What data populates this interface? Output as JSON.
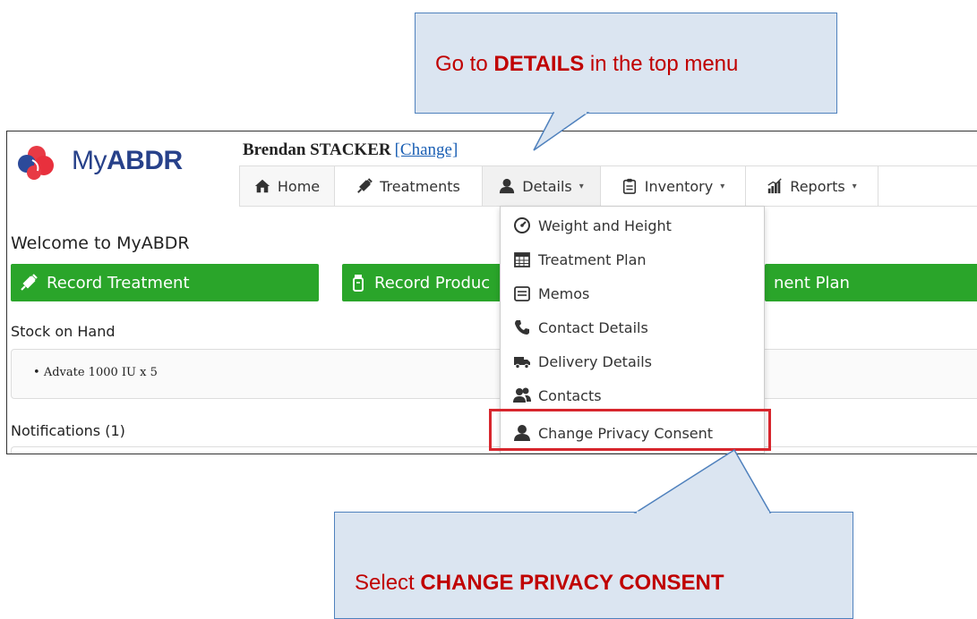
{
  "annotations": {
    "top": {
      "prefix": "Go to ",
      "emphasis": "DETAILS",
      "suffix": " in the top menu"
    },
    "bottom": {
      "prefix": "Select ",
      "emphasis": "CHANGE PRIVACY CONSENT"
    },
    "callout_fill": "#dbe5f1",
    "callout_border": "#4f81bd",
    "text_color": "#c00000",
    "highlight_color": "#d7262d"
  },
  "app": {
    "logo": {
      "light": "My",
      "bold": "ABDR"
    },
    "user": {
      "name": "Brendan STACKER",
      "change_link": "[Change]"
    }
  },
  "nav": {
    "home": {
      "label": "Home",
      "icon": "home-icon"
    },
    "treatments": {
      "label": "Treatments",
      "icon": "syringe-icon"
    },
    "details": {
      "label": "Details",
      "icon": "user-icon"
    },
    "inventory": {
      "label": "Inventory",
      "icon": "clipboard-icon"
    },
    "reports": {
      "label": "Reports",
      "icon": "bar-chart-icon"
    },
    "caret": "▾"
  },
  "details_menu": {
    "items": [
      {
        "label": "Weight and Height",
        "icon": "dashboard-icon"
      },
      {
        "label": "Treatment Plan",
        "icon": "calendar-icon"
      },
      {
        "label": "Memos",
        "icon": "memo-icon"
      },
      {
        "label": "Contact Details",
        "icon": "phone-icon"
      },
      {
        "label": "Delivery Details",
        "icon": "truck-icon"
      },
      {
        "label": "Contacts",
        "icon": "users-icon"
      },
      {
        "label": "Change Privacy Consent",
        "icon": "user-icon"
      }
    ]
  },
  "page": {
    "welcome": "Welcome to MyABDR",
    "buttons": {
      "record_treatment": "Record Treatment",
      "record_product": "Record Produc",
      "treatment_plan": "nent Plan"
    },
    "button_color": "#2aa52a",
    "stock_title": "Stock on Hand",
    "stock_items": [
      "Advate 1000 IU x 5"
    ],
    "notifications": "Notifications (1)"
  }
}
